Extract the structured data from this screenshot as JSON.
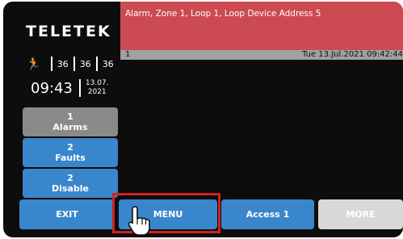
{
  "brand": {
    "logo_text": "TELETEK"
  },
  "status": {
    "icon": "evacuation-exit-icon",
    "counter_1": "36",
    "counter_2": "36",
    "counter_3": "36"
  },
  "clock": {
    "time": "09:43",
    "date_line1": "13.07.",
    "date_line2": "2021"
  },
  "sidebar": {
    "alarms": {
      "count": "1",
      "label": "Alarms"
    },
    "faults": {
      "count": "2",
      "label": "Faults"
    },
    "disable": {
      "count": "2",
      "label": "Disable"
    }
  },
  "alarm": {
    "message": "Alarm, Zone 1, Loop 1, Loop Device Address 5",
    "number": "1",
    "timestamp": "Tue 13.Jul.2021 09:42:44"
  },
  "bottom": {
    "exit_label": "EXIT",
    "menu_label": "MENU",
    "access_label": "Access 1",
    "more_label": "MORE"
  },
  "colors": {
    "alarm_red": "#cc4a51",
    "button_blue": "#3a86cc",
    "button_gray": "#8a8a8a",
    "highlight_red": "#d42020",
    "background": "#0d0d0d"
  }
}
